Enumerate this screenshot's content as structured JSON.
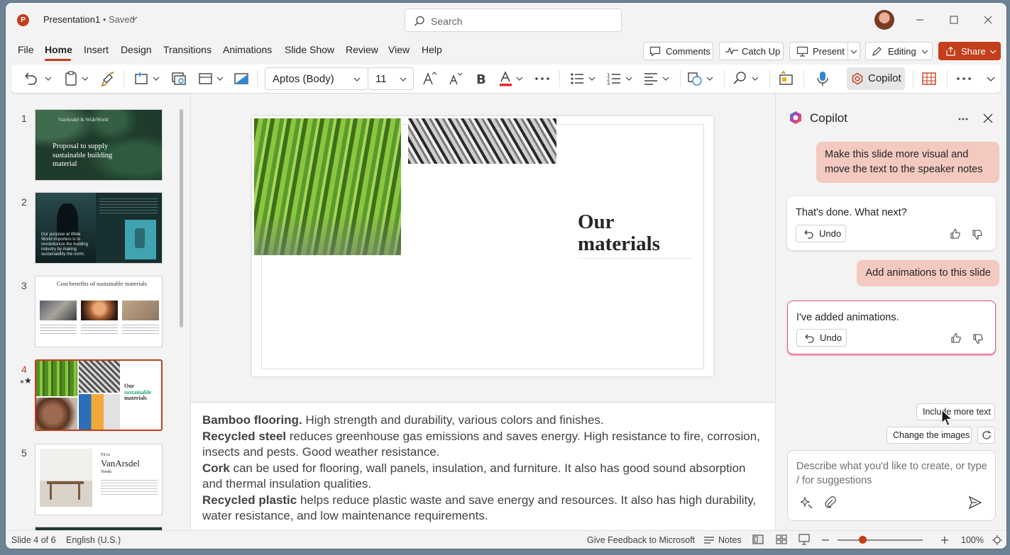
{
  "title_bar": {
    "app_icon_letter": "P",
    "document_name": "Presentation1",
    "save_status": "• Saved",
    "search_placeholder": "Search"
  },
  "menu": {
    "items": [
      "File",
      "Home",
      "Insert",
      "Design",
      "Transitions",
      "Animations",
      "Slide Show",
      "Review",
      "View",
      "Help"
    ],
    "active": "Home",
    "comments": "Comments",
    "catch_up": "Catch Up",
    "present": "Present",
    "editing": "Editing",
    "share": "Share"
  },
  "ribbon": {
    "font_name": "Aptos (Body)",
    "font_size": "11",
    "copilot": "Copilot",
    "font_color": "#e3262d"
  },
  "slides": [
    {
      "number": "1",
      "title": "Proposal to supply sustainable building material"
    },
    {
      "number": "2",
      "title": "Our purpose at Wide World Importers is to revolutionize the building industry by making sustainability the norm."
    },
    {
      "number": "3",
      "title": "Cost benefits of sustainable materials"
    },
    {
      "number": "4",
      "title": "Our sustainable materials",
      "title_line1": "Our",
      "title_line2": "sustainable",
      "title_line3": "materials"
    },
    {
      "number": "5",
      "title": "Fit to VanArsdel Needs",
      "title_line1": "Fit to",
      "title_line2": "VanArsdel",
      "title_line3": "Needs"
    }
  ],
  "slide1_brand": "VanArsdel  &  WideWorld",
  "current_slide": {
    "title_line1": "Our",
    "title_line2": "materials"
  },
  "notes": [
    {
      "bold": "Bamboo flooring.",
      "text": " High strength and durability, various colors and finishes."
    },
    {
      "bold": "Recycled steel",
      "text": " reduces greenhouse gas emissions and saves energy. High resistance to fire, corrosion, insects and pests. Good weather resistance."
    },
    {
      "bold": "Cork",
      "text": " can be used for flooring, wall panels, insulation, and furniture. It also has good sound absorption and thermal insulation qualities."
    },
    {
      "bold": "Recycled plastic",
      "text": " helps reduce plastic waste and save energy and resources. It also has high durability, water resistance, and low maintenance requirements."
    }
  ],
  "copilot": {
    "title": "Copilot",
    "user_msg_1": "Make this slide more visual and move the text to the speaker notes",
    "assistant_msg_1": "That's done. What next?",
    "user_msg_2": "Add animations to this slide",
    "assistant_msg_2": "I've added animations.",
    "undo": "Undo",
    "suggestion_1": "Include more text",
    "suggestion_2": "Change the images",
    "input_placeholder": "Describe what you'd like to create, or type / for suggestions"
  },
  "status_bar": {
    "slide_info": "Slide 4 of 6",
    "language": "English (U.S.)",
    "feedback": "Give Feedback to Microsoft",
    "notes": "Notes",
    "zoom": "100%"
  },
  "colors": {
    "accent": "#c43e1c",
    "user_bubble": "#f3c9c0"
  }
}
